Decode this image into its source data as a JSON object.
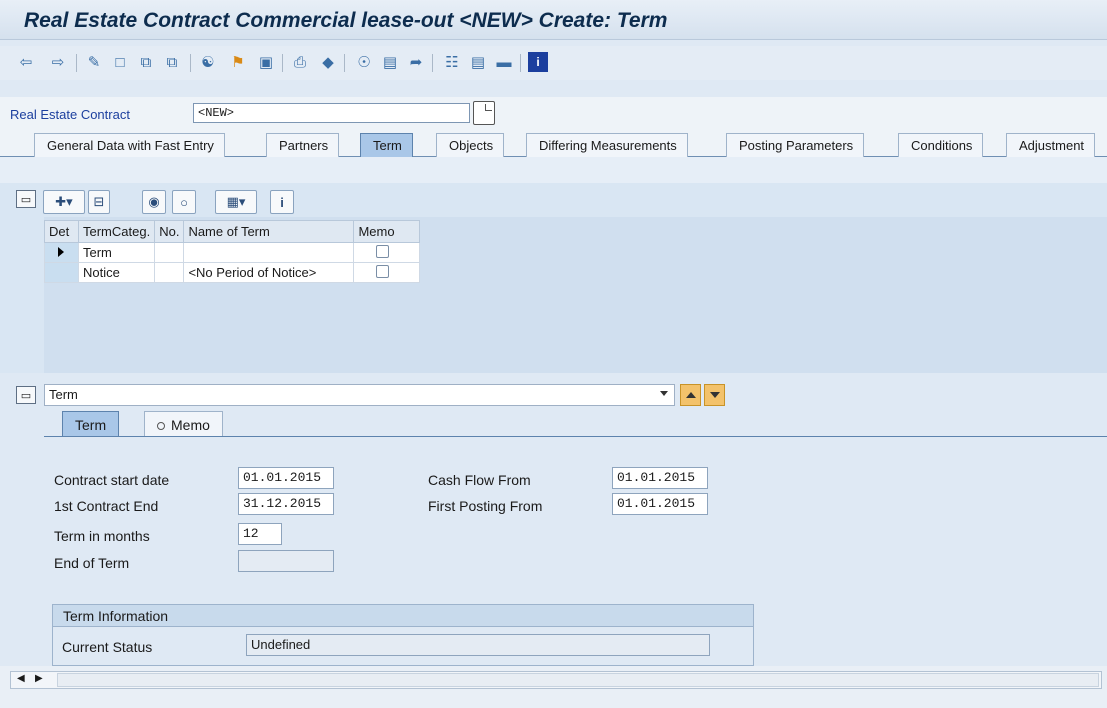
{
  "window": {
    "title": "Real Estate Contract Commercial lease-out <NEW> Create: Term"
  },
  "toolbar": {
    "icons": [
      "back-arrow-icon",
      "forward-arrow-icon",
      "edit-icon",
      "new-document-icon",
      "copy-icon",
      "copy-reference-icon",
      "hierarchy-icon",
      "pin-icon",
      "save-icon",
      "print-icon",
      "delete-icon",
      "object-icon",
      "documents-icon",
      "send-icon",
      "structure-icon",
      "table-icon",
      "display-icon",
      "info-icon"
    ]
  },
  "header": {
    "record_label": "Real Estate Contract",
    "record_value": "<NEW>"
  },
  "tabs": [
    {
      "label": "General Data with Fast Entry",
      "active": false
    },
    {
      "label": "Partners",
      "active": false
    },
    {
      "label": "Term",
      "active": true
    },
    {
      "label": "Objects",
      "active": false
    },
    {
      "label": "Differing Measurements",
      "active": false
    },
    {
      "label": "Posting Parameters",
      "active": false
    },
    {
      "label": "Conditions",
      "active": false
    },
    {
      "label": "Adjustment",
      "active": false
    }
  ],
  "grid": {
    "columns": [
      "Det",
      "TermCateg.",
      "No.",
      "Name of Term",
      "Memo"
    ],
    "rows": [
      {
        "selected": true,
        "category": "Term",
        "number": "",
        "name": "",
        "memo": false
      },
      {
        "selected": false,
        "category": "Notice",
        "number": "",
        "name": "<No Period of Notice>",
        "memo": false
      }
    ]
  },
  "detail": {
    "selector_value": "Term",
    "tabs": [
      {
        "label": "Term",
        "active": true
      },
      {
        "label": "Memo",
        "active": false
      }
    ],
    "fields": {
      "contract_start_label": "Contract start date",
      "contract_start_value": "01.01.2015",
      "first_end_label": "1st Contract End",
      "first_end_value": "31.12.2015",
      "term_months_label": "Term in months",
      "term_months_value": "12",
      "end_of_term_label": "End of Term",
      "end_of_term_value": "",
      "cash_flow_label": "Cash Flow From",
      "cash_flow_value": "01.01.2015",
      "first_posting_label": "First Posting From",
      "first_posting_value": "01.01.2015"
    },
    "term_info": {
      "title": "Term Information",
      "status_label": "Current Status",
      "status_value": "Undefined"
    }
  },
  "colors": {
    "accent": "#a9c7e8",
    "title": "#0d2c4e",
    "label_link": "#1c3f9e",
    "nav_button": "#f3c26b"
  }
}
